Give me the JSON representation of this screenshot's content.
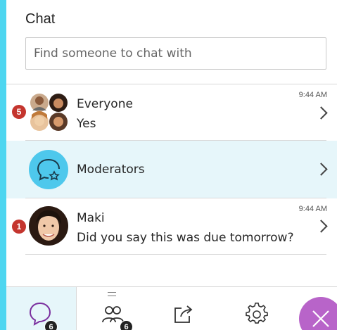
{
  "header": {
    "title": "Chat"
  },
  "search": {
    "placeholder": "Find someone to chat with"
  },
  "conversations": [
    {
      "name": "Everyone",
      "message": "Yes",
      "time": "9:44 AM",
      "unread": "5"
    },
    {
      "name": "Moderators",
      "message": "",
      "time": "",
      "unread": ""
    },
    {
      "name": "Maki",
      "message": "Did you say this was due tomorrow?",
      "time": "9:44 AM",
      "unread": "1"
    }
  ],
  "bottom_tabs": [
    {
      "icon": "chat-icon",
      "count": "6"
    },
    {
      "icon": "attendees-icon",
      "count": "6"
    },
    {
      "icon": "share-icon"
    },
    {
      "icon": "settings-icon"
    },
    {
      "icon": "close-icon"
    }
  ],
  "colors": {
    "frame": "#4ed6f0",
    "highlight": "#e6f6fa",
    "unread_badge": "#c4352e",
    "moderators_avatar": "#4ec8ec",
    "close_button": "#b864c9"
  }
}
